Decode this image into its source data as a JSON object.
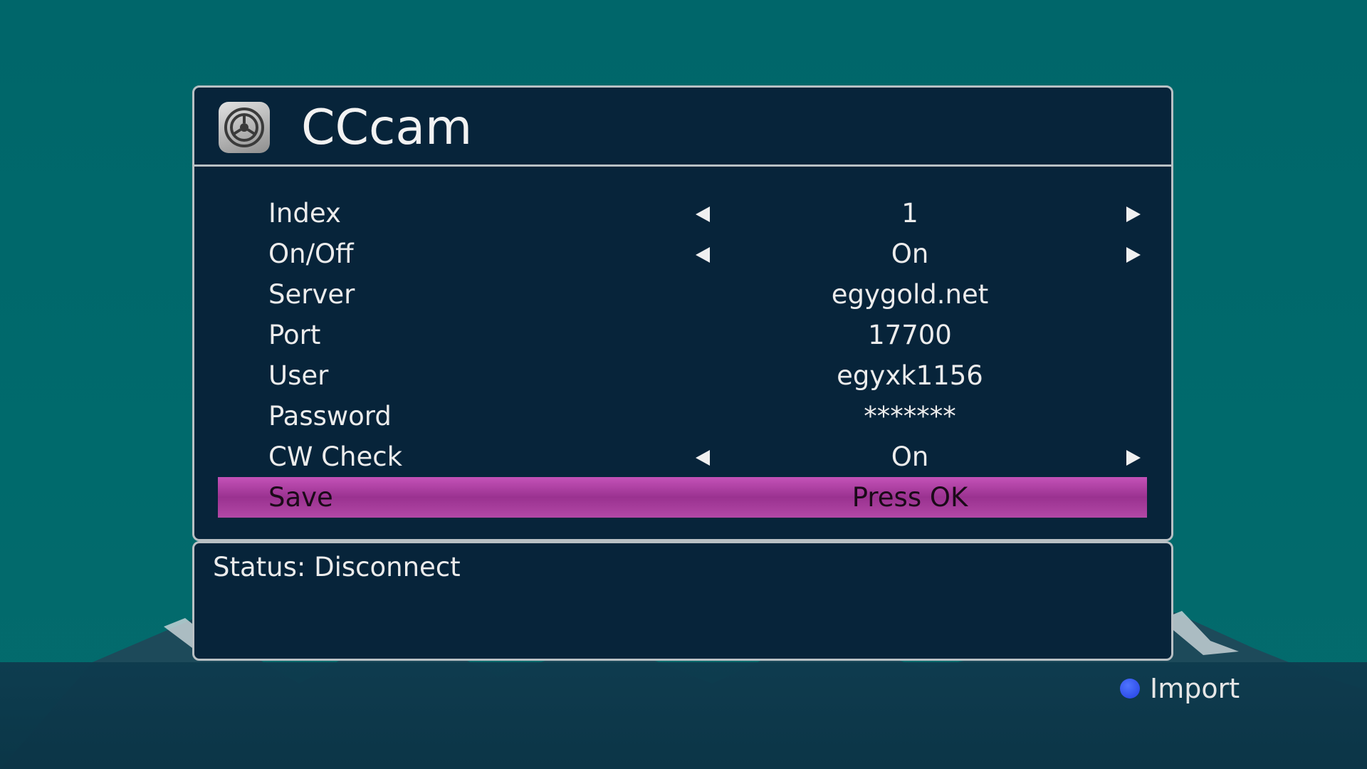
{
  "title": "CCcam",
  "rows": [
    {
      "label": "Index",
      "value": "1",
      "has_arrows": true
    },
    {
      "label": "On/Off",
      "value": "On",
      "has_arrows": true
    },
    {
      "label": "Server",
      "value": "egygold.net",
      "has_arrows": false
    },
    {
      "label": "Port",
      "value": "17700",
      "has_arrows": false
    },
    {
      "label": "User",
      "value": "egyxk1156",
      "has_arrows": false
    },
    {
      "label": "Password",
      "value": "*******",
      "has_arrows": false
    },
    {
      "label": "CW Check",
      "value": "On",
      "has_arrows": true
    },
    {
      "label": "Save",
      "value": "Press OK",
      "has_arrows": false,
      "selected": true
    }
  ],
  "status": "Status: Disconnect",
  "import_hint": {
    "label": "Import",
    "color": "#2f50f0"
  },
  "icons": {
    "app": "settings-gear-icon"
  },
  "colors": {
    "background": "#00666a",
    "panel": "#07243a",
    "border": "#b9c0c4",
    "highlight": "#a83aa0"
  }
}
